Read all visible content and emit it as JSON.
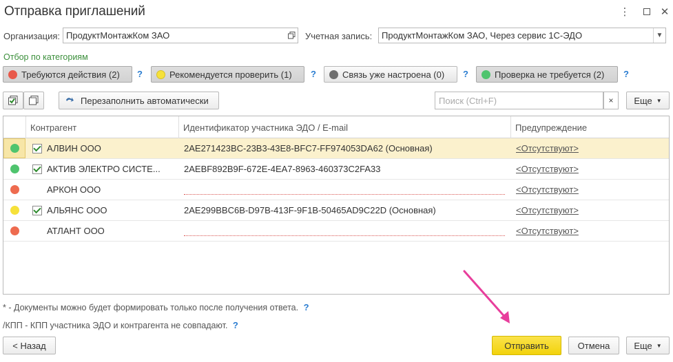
{
  "window": {
    "title": "Отправка приглашений"
  },
  "form": {
    "org_label": "Организация:",
    "org_value": "ПродуктМонтажКом ЗАО",
    "account_label": "Учетная запись:",
    "account_value": "ПродуктМонтажКом ЗАО, Через сервис 1С-ЭДО"
  },
  "filter": {
    "label": "Отбор по категориям",
    "categories": [
      {
        "label": "Требуются действия (2)",
        "color": "#e8594a",
        "pressed": true
      },
      {
        "label": "Рекомендуется проверить (1)",
        "color": "#f6e13a",
        "pressed": true
      },
      {
        "label": "Связь уже настроена (0)",
        "color": "#6f6f6f",
        "pressed": false
      },
      {
        "label": "Проверка не требуется (2)",
        "color": "#4fc46e",
        "pressed": true
      }
    ],
    "help": "?"
  },
  "toolbar": {
    "refill_label": "Перезаполнить автоматически",
    "search_placeholder": "Поиск (Ctrl+F)",
    "clear": "×",
    "more_label": "Еще"
  },
  "table": {
    "columns": [
      "Контрагент",
      "Идентификатор участника ЭДО / E-mail",
      "Предупреждение"
    ],
    "rows": [
      {
        "status": "green",
        "checked": true,
        "name": "АЛВИН ООО",
        "id": "2AE271423BC-23B3-43E8-BFC7-FF974053DA62 (Основная)",
        "warning": "<Отсутствуют>",
        "selected": true
      },
      {
        "status": "green",
        "checked": true,
        "name": "АКТИВ ЭЛЕКТРО СИСТЕ...",
        "id": "2AEBF892B9F-672E-4EA7-8963-460373C2FA33",
        "warning": "<Отсутствуют>",
        "selected": false
      },
      {
        "status": "red",
        "checked": false,
        "name": "АРКОН ООО",
        "id": "",
        "warning": "<Отсутствуют>",
        "selected": false
      },
      {
        "status": "yellow",
        "checked": true,
        "name": "АЛЬЯНС ООО",
        "id": "2AE299BBC6B-D97B-413F-9F1B-50465AD9C22D (Основная)",
        "warning": "<Отсутствуют>",
        "selected": false
      },
      {
        "status": "red",
        "checked": false,
        "name": "АТЛАНТ ООО",
        "id": "",
        "warning": "<Отсутствуют>",
        "selected": false
      }
    ]
  },
  "notes": {
    "note1": "* - Документы можно будет формировать только после получения ответа.",
    "note2": "/КПП - КПП участника ЭДО и контрагента не совпадают.",
    "help": "?"
  },
  "footer": {
    "back_label": "< Назад",
    "send_label": "Отправить",
    "cancel_label": "Отмена",
    "more_label": "Еще"
  },
  "colors": {
    "accent_yellow": "#f2d20c",
    "selected_row": "#fbf1cd",
    "arrow": "#e83e9c",
    "help": "#2a7dd1",
    "filter_label": "#3c8f3c"
  }
}
